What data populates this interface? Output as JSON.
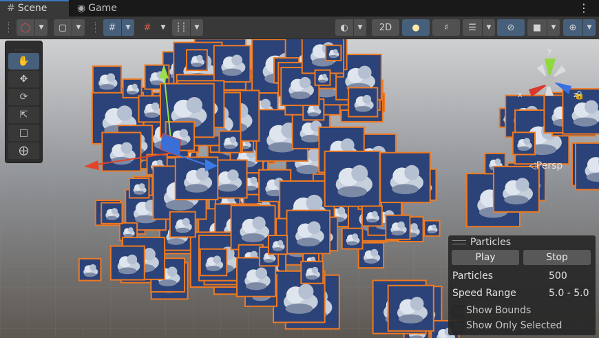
{
  "tabs": [
    {
      "label": "Scene",
      "icon": "grid-icon"
    },
    {
      "label": "Game",
      "icon": "gamepad-icon"
    }
  ],
  "toolbar": {
    "toggle_2d": "2D"
  },
  "gizmo": {
    "axis_x": "x",
    "axis_y": "y",
    "axis_z": "z",
    "projection": "Persp"
  },
  "particles_panel": {
    "title": "Particles",
    "play_label": "Play",
    "stop_label": "Stop",
    "particles_label": "Particles",
    "particles_value": "500",
    "speed_label": "Speed Range",
    "speed_value": "5.0 - 5.0",
    "show_bounds_label": "Show Bounds",
    "show_only_selected_label": "Show Only Selected",
    "show_bounds_checked": false,
    "show_only_selected_checked": false
  },
  "colors": {
    "selection_outline": "#f07a21",
    "active_button": "#46607c",
    "panel_bg": "#383838"
  }
}
